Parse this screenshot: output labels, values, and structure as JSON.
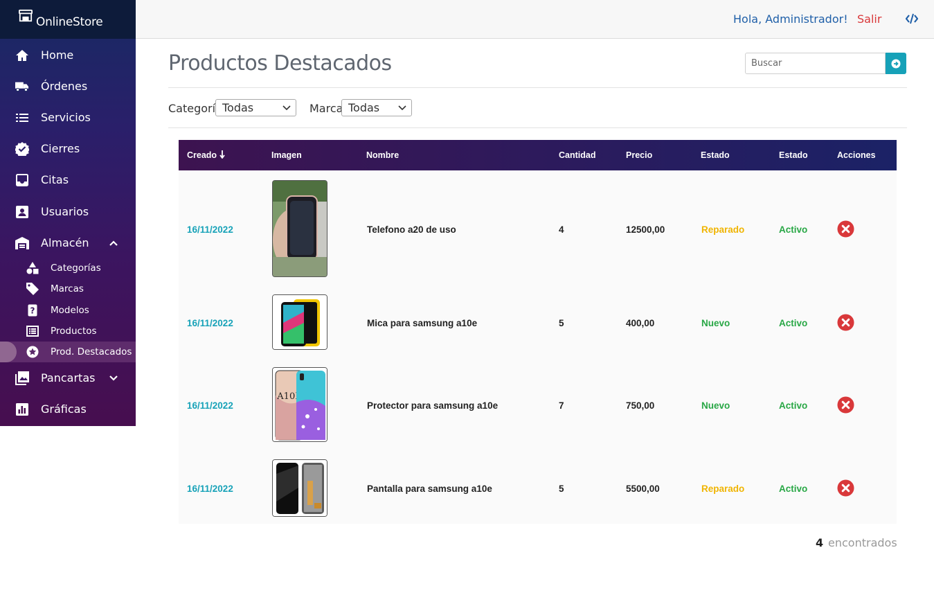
{
  "brand": {
    "name": "OnlineStore"
  },
  "sidebar": {
    "items": [
      {
        "label": "Home",
        "icon": "home-icon"
      },
      {
        "label": "Órdenes",
        "icon": "truck-icon"
      },
      {
        "label": "Servicios",
        "icon": "list-icon"
      },
      {
        "label": "Cierres",
        "icon": "badge-check-icon"
      },
      {
        "label": "Citas",
        "icon": "inbox-icon"
      },
      {
        "label": "Usuarios",
        "icon": "user-card-icon"
      },
      {
        "label": "Almacén",
        "icon": "warehouse-icon",
        "expanded": true
      },
      {
        "label": "Pancartas",
        "icon": "image-icon",
        "expanded": false
      },
      {
        "label": "Gráficas",
        "icon": "chart-icon"
      }
    ],
    "sub_items": [
      {
        "label": "Categorías",
        "icon": "shapes-icon"
      },
      {
        "label": "Marcas",
        "icon": "tag-icon"
      },
      {
        "label": "Modelos",
        "icon": "phone-question-icon"
      },
      {
        "label": "Productos",
        "icon": "list-alt-icon"
      },
      {
        "label": "Prod. Destacados",
        "icon": "star-circle-icon",
        "active": true
      }
    ]
  },
  "topbar": {
    "greeting": "Hola, Administrador!",
    "logout": "Salir"
  },
  "main": {
    "title": "Productos Destacados",
    "search": {
      "placeholder": "Buscar",
      "value": ""
    },
    "filters": {
      "category_label": "Categoría",
      "category_value": "Todas",
      "brand_label": "Marca",
      "brand_value": "Todas"
    }
  },
  "table": {
    "headers": [
      "Creado",
      "Imagen",
      "Nombre",
      "Cantidad",
      "Precio",
      "Estado",
      "Estado",
      "Acciones"
    ],
    "rows": [
      {
        "created": "16/11/2022",
        "name": "Telefono a20 de uso",
        "quantity": "4",
        "price": "12500,00",
        "condition": "Reparado",
        "status": "Activo"
      },
      {
        "created": "16/11/2022",
        "name": "Mica para samsung a10e",
        "quantity": "5",
        "price": "400,00",
        "condition": "Nuevo",
        "status": "Activo"
      },
      {
        "created": "16/11/2022",
        "name": "Protector para samsung a10e",
        "quantity": "7",
        "price": "750,00",
        "condition": "Nuevo",
        "status": "Activo"
      },
      {
        "created": "16/11/2022",
        "name": "Pantalla para samsung a10e",
        "quantity": "5",
        "price": "5500,00",
        "condition": "Reparado",
        "status": "Activo"
      }
    ]
  },
  "footer": {
    "count": "4",
    "label": "encontrados"
  },
  "colors": {
    "accent": "#17a2b8",
    "reparado": "#f0b400",
    "nuevo": "#28a745",
    "activo": "#28a745",
    "delete": "#d9383a",
    "logout": "#d9383a",
    "greeting": "#1f5fa8"
  }
}
